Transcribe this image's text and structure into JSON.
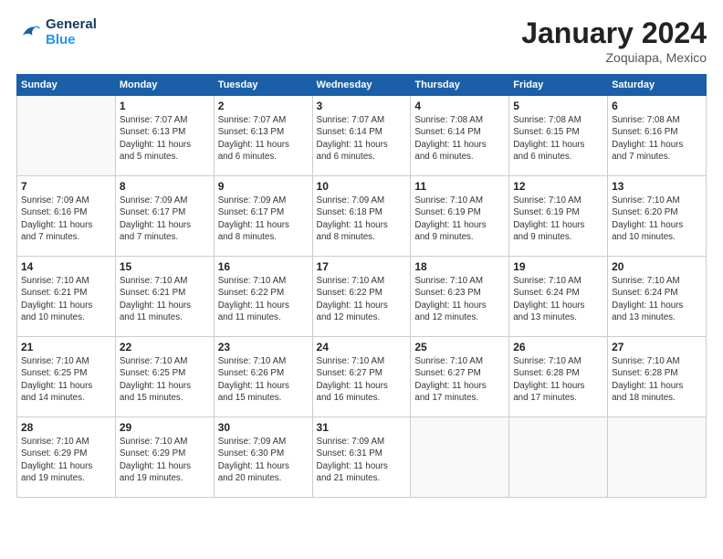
{
  "logo": {
    "line1": "General",
    "line2": "Blue"
  },
  "title": "January 2024",
  "subtitle": "Zoquiapa, Mexico",
  "days": [
    "Sunday",
    "Monday",
    "Tuesday",
    "Wednesday",
    "Thursday",
    "Friday",
    "Saturday"
  ],
  "weeks": [
    [
      {
        "num": "",
        "info": ""
      },
      {
        "num": "1",
        "info": "Sunrise: 7:07 AM\nSunset: 6:13 PM\nDaylight: 11 hours\nand 5 minutes."
      },
      {
        "num": "2",
        "info": "Sunrise: 7:07 AM\nSunset: 6:13 PM\nDaylight: 11 hours\nand 6 minutes."
      },
      {
        "num": "3",
        "info": "Sunrise: 7:07 AM\nSunset: 6:14 PM\nDaylight: 11 hours\nand 6 minutes."
      },
      {
        "num": "4",
        "info": "Sunrise: 7:08 AM\nSunset: 6:14 PM\nDaylight: 11 hours\nand 6 minutes."
      },
      {
        "num": "5",
        "info": "Sunrise: 7:08 AM\nSunset: 6:15 PM\nDaylight: 11 hours\nand 6 minutes."
      },
      {
        "num": "6",
        "info": "Sunrise: 7:08 AM\nSunset: 6:16 PM\nDaylight: 11 hours\nand 7 minutes."
      }
    ],
    [
      {
        "num": "7",
        "info": "Sunrise: 7:09 AM\nSunset: 6:16 PM\nDaylight: 11 hours\nand 7 minutes."
      },
      {
        "num": "8",
        "info": "Sunrise: 7:09 AM\nSunset: 6:17 PM\nDaylight: 11 hours\nand 7 minutes."
      },
      {
        "num": "9",
        "info": "Sunrise: 7:09 AM\nSunset: 6:17 PM\nDaylight: 11 hours\nand 8 minutes."
      },
      {
        "num": "10",
        "info": "Sunrise: 7:09 AM\nSunset: 6:18 PM\nDaylight: 11 hours\nand 8 minutes."
      },
      {
        "num": "11",
        "info": "Sunrise: 7:10 AM\nSunset: 6:19 PM\nDaylight: 11 hours\nand 9 minutes."
      },
      {
        "num": "12",
        "info": "Sunrise: 7:10 AM\nSunset: 6:19 PM\nDaylight: 11 hours\nand 9 minutes."
      },
      {
        "num": "13",
        "info": "Sunrise: 7:10 AM\nSunset: 6:20 PM\nDaylight: 11 hours\nand 10 minutes."
      }
    ],
    [
      {
        "num": "14",
        "info": "Sunrise: 7:10 AM\nSunset: 6:21 PM\nDaylight: 11 hours\nand 10 minutes."
      },
      {
        "num": "15",
        "info": "Sunrise: 7:10 AM\nSunset: 6:21 PM\nDaylight: 11 hours\nand 11 minutes."
      },
      {
        "num": "16",
        "info": "Sunrise: 7:10 AM\nSunset: 6:22 PM\nDaylight: 11 hours\nand 11 minutes."
      },
      {
        "num": "17",
        "info": "Sunrise: 7:10 AM\nSunset: 6:22 PM\nDaylight: 11 hours\nand 12 minutes."
      },
      {
        "num": "18",
        "info": "Sunrise: 7:10 AM\nSunset: 6:23 PM\nDaylight: 11 hours\nand 12 minutes."
      },
      {
        "num": "19",
        "info": "Sunrise: 7:10 AM\nSunset: 6:24 PM\nDaylight: 11 hours\nand 13 minutes."
      },
      {
        "num": "20",
        "info": "Sunrise: 7:10 AM\nSunset: 6:24 PM\nDaylight: 11 hours\nand 13 minutes."
      }
    ],
    [
      {
        "num": "21",
        "info": "Sunrise: 7:10 AM\nSunset: 6:25 PM\nDaylight: 11 hours\nand 14 minutes."
      },
      {
        "num": "22",
        "info": "Sunrise: 7:10 AM\nSunset: 6:25 PM\nDaylight: 11 hours\nand 15 minutes."
      },
      {
        "num": "23",
        "info": "Sunrise: 7:10 AM\nSunset: 6:26 PM\nDaylight: 11 hours\nand 15 minutes."
      },
      {
        "num": "24",
        "info": "Sunrise: 7:10 AM\nSunset: 6:27 PM\nDaylight: 11 hours\nand 16 minutes."
      },
      {
        "num": "25",
        "info": "Sunrise: 7:10 AM\nSunset: 6:27 PM\nDaylight: 11 hours\nand 17 minutes."
      },
      {
        "num": "26",
        "info": "Sunrise: 7:10 AM\nSunset: 6:28 PM\nDaylight: 11 hours\nand 17 minutes."
      },
      {
        "num": "27",
        "info": "Sunrise: 7:10 AM\nSunset: 6:28 PM\nDaylight: 11 hours\nand 18 minutes."
      }
    ],
    [
      {
        "num": "28",
        "info": "Sunrise: 7:10 AM\nSunset: 6:29 PM\nDaylight: 11 hours\nand 19 minutes."
      },
      {
        "num": "29",
        "info": "Sunrise: 7:10 AM\nSunset: 6:29 PM\nDaylight: 11 hours\nand 19 minutes."
      },
      {
        "num": "30",
        "info": "Sunrise: 7:09 AM\nSunset: 6:30 PM\nDaylight: 11 hours\nand 20 minutes."
      },
      {
        "num": "31",
        "info": "Sunrise: 7:09 AM\nSunset: 6:31 PM\nDaylight: 11 hours\nand 21 minutes."
      },
      {
        "num": "",
        "info": ""
      },
      {
        "num": "",
        "info": ""
      },
      {
        "num": "",
        "info": ""
      }
    ]
  ]
}
